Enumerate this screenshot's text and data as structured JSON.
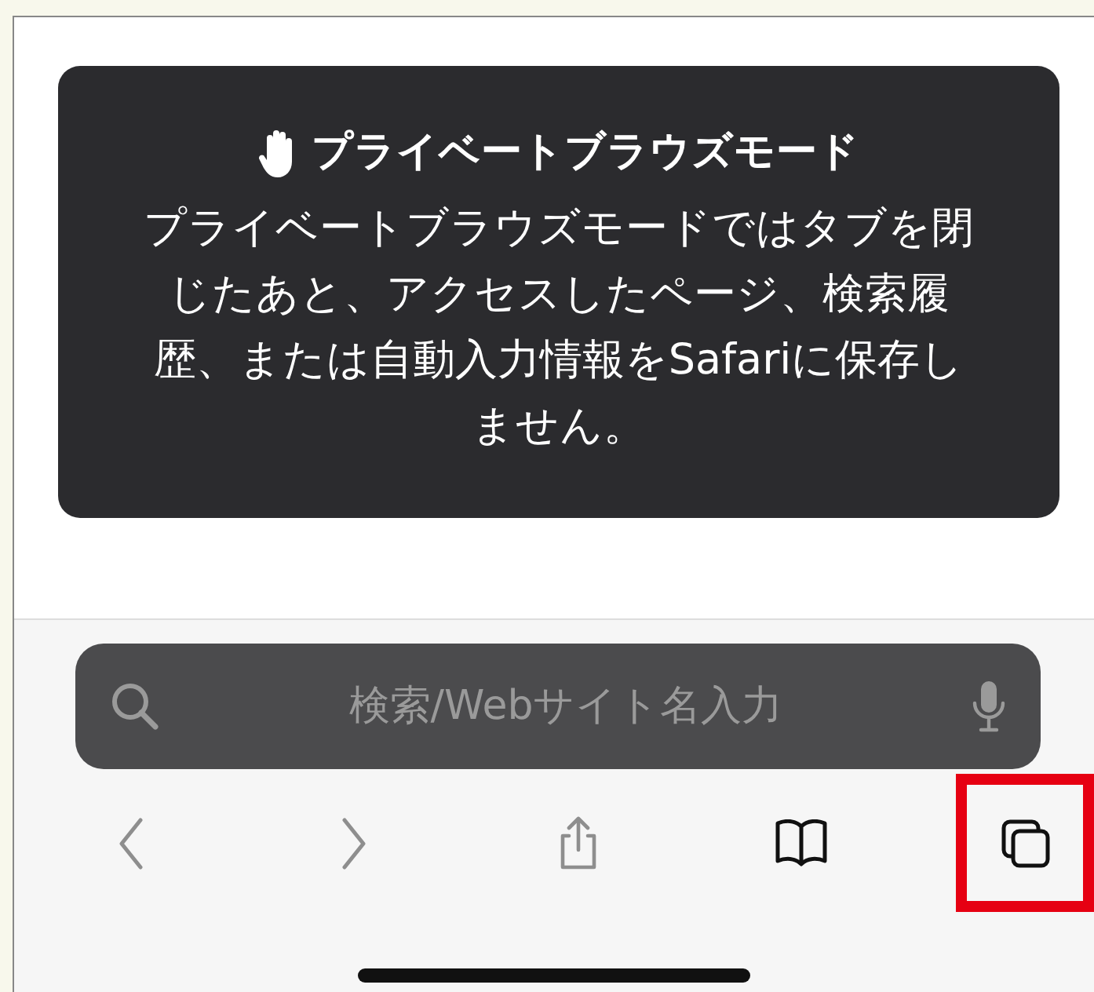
{
  "private_notice": {
    "title": "プライベートブラウズモード",
    "body": "プライベートブラウズモードではタブを閉じたあと、アクセスしたページ、検索履歴、または自動入力情報をSafariに保存しません。"
  },
  "search": {
    "placeholder": "検索/Webサイト名入力"
  },
  "toolbar": {
    "buttons": [
      {
        "kind": "back",
        "disabled": true,
        "highlighted": false
      },
      {
        "kind": "forward",
        "disabled": true,
        "highlighted": false
      },
      {
        "kind": "share",
        "disabled": true,
        "highlighted": false
      },
      {
        "kind": "bookmarks",
        "disabled": false,
        "highlighted": false
      },
      {
        "kind": "tabs",
        "disabled": false,
        "highlighted": true
      }
    ]
  }
}
